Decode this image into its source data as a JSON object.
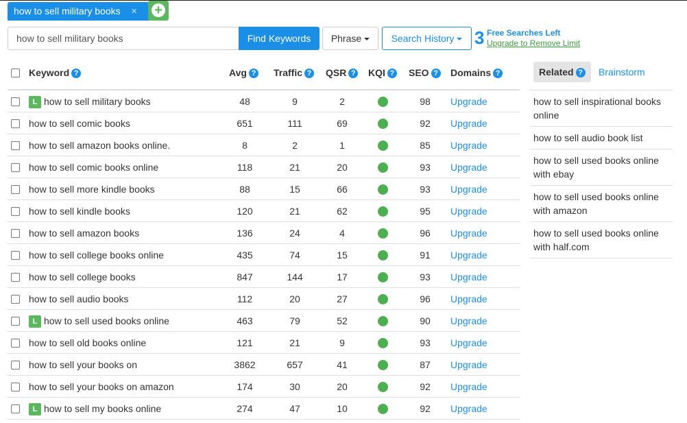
{
  "tab": {
    "label": "how to sell military books",
    "close": "×"
  },
  "add_tab": {
    "symbol": "+"
  },
  "search": {
    "value": "how to sell military books",
    "find_label": "Find Keywords"
  },
  "phrase_label": "Phrase",
  "history_label": "Search History",
  "free": {
    "count": "3",
    "text": "Free Searches Left",
    "upgrade": "Upgrade to Remove Limit"
  },
  "headers": {
    "keyword": "Keyword",
    "avg": "Avg",
    "traffic": "Traffic",
    "qsr": "QSR",
    "kqi": "KQI",
    "seo": "SEO",
    "domains": "Domains",
    "q": "?"
  },
  "colors": {
    "accent": "#1a8fe8",
    "green": "#5cb85c",
    "kqi": "#4caf50"
  },
  "badge_text": "L",
  "rows": [
    {
      "keyword": "how to sell military books",
      "L": true,
      "avg": "48",
      "traffic": "9",
      "qsr": "2",
      "seo": "98",
      "domains": "Upgrade"
    },
    {
      "keyword": "how to sell comic books",
      "L": false,
      "avg": "651",
      "traffic": "111",
      "qsr": "69",
      "seo": "92",
      "domains": "Upgrade"
    },
    {
      "keyword": "how to sell amazon books online.",
      "L": false,
      "avg": "8",
      "traffic": "2",
      "qsr": "1",
      "seo": "85",
      "domains": "Upgrade"
    },
    {
      "keyword": "how to sell comic books online",
      "L": false,
      "avg": "118",
      "traffic": "21",
      "qsr": "20",
      "seo": "93",
      "domains": "Upgrade"
    },
    {
      "keyword": "how to sell more kindle books",
      "L": false,
      "avg": "88",
      "traffic": "15",
      "qsr": "66",
      "seo": "93",
      "domains": "Upgrade"
    },
    {
      "keyword": "how to sell kindle books",
      "L": false,
      "avg": "120",
      "traffic": "21",
      "qsr": "62",
      "seo": "95",
      "domains": "Upgrade"
    },
    {
      "keyword": "how to sell amazon books",
      "L": false,
      "avg": "136",
      "traffic": "24",
      "qsr": "4",
      "seo": "96",
      "domains": "Upgrade"
    },
    {
      "keyword": "how to sell college books online",
      "L": false,
      "avg": "435",
      "traffic": "74",
      "qsr": "15",
      "seo": "91",
      "domains": "Upgrade"
    },
    {
      "keyword": "how to sell college books",
      "L": false,
      "avg": "847",
      "traffic": "144",
      "qsr": "17",
      "seo": "93",
      "domains": "Upgrade"
    },
    {
      "keyword": "how to sell audio books",
      "L": false,
      "avg": "112",
      "traffic": "20",
      "qsr": "27",
      "seo": "96",
      "domains": "Upgrade"
    },
    {
      "keyword": "how to sell used books online",
      "L": true,
      "avg": "463",
      "traffic": "79",
      "qsr": "52",
      "seo": "90",
      "domains": "Upgrade"
    },
    {
      "keyword": "how to sell old books online",
      "L": false,
      "avg": "121",
      "traffic": "21",
      "qsr": "9",
      "seo": "93",
      "domains": "Upgrade"
    },
    {
      "keyword": "how to sell your books on",
      "L": false,
      "avg": "3862",
      "traffic": "657",
      "qsr": "41",
      "seo": "87",
      "domains": "Upgrade"
    },
    {
      "keyword": "how to sell your books on amazon",
      "L": false,
      "avg": "174",
      "traffic": "30",
      "qsr": "20",
      "seo": "92",
      "domains": "Upgrade"
    },
    {
      "keyword": "how to sell my books online",
      "L": true,
      "avg": "274",
      "traffic": "47",
      "qsr": "10",
      "seo": "92",
      "domains": "Upgrade"
    }
  ],
  "related": {
    "tab_label": "Related",
    "brainstorm_label": "Brainstorm",
    "items": [
      "how to sell inspirational books online",
      "how to sell audio book list",
      "how to sell used books online with ebay",
      "how to sell used books online with amazon",
      "how to sell used books online with half.com"
    ]
  }
}
